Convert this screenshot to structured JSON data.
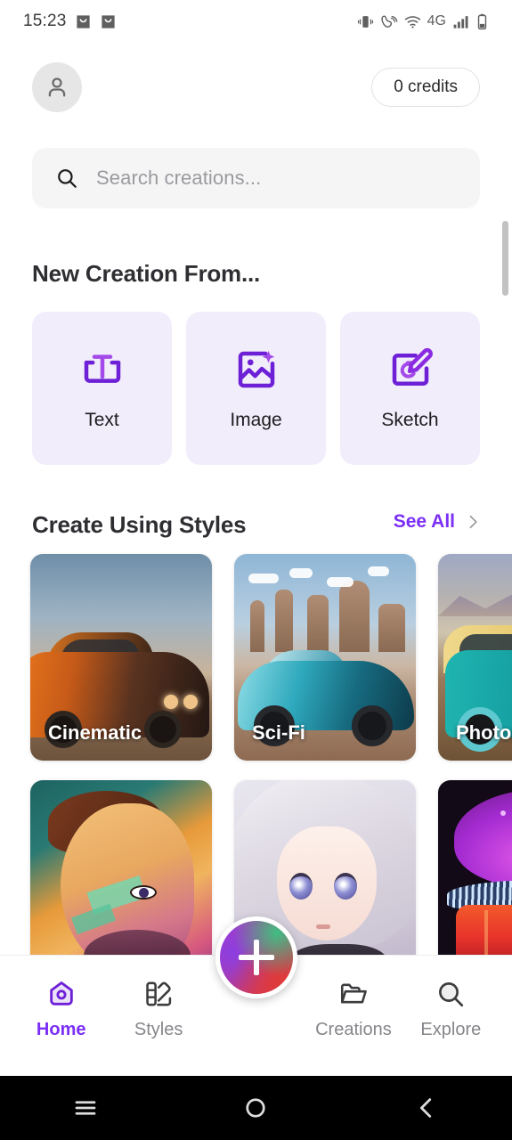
{
  "status_bar": {
    "time": "15:23",
    "left_icons": [
      "inbox-icon",
      "inbox-icon"
    ],
    "right_icons": [
      "vibrate-icon",
      "wifi-calling-icon",
      "wifi-icon",
      "signal-bars-icon",
      "battery-icon"
    ],
    "network_label": "4G"
  },
  "top_bar": {
    "avatar_icon": "person-icon",
    "credits_label": "0 credits"
  },
  "search": {
    "icon": "search-icon",
    "placeholder": "Search creations...",
    "value": ""
  },
  "new_creation": {
    "heading": "New Creation From...",
    "cards": [
      {
        "label": "Text",
        "icon": "text-box-icon"
      },
      {
        "label": "Image",
        "icon": "image-sparkle-icon"
      },
      {
        "label": "Sketch",
        "icon": "sketch-pencil-icon"
      }
    ]
  },
  "styles_section": {
    "heading": "Create Using Styles",
    "see_all_label": "See All",
    "chevron_icon": "chevron-right-icon",
    "row1": [
      {
        "label": "Cinematic",
        "art": "cinematic"
      },
      {
        "label": "Sci-Fi",
        "art": "scifi"
      },
      {
        "label": "Photographic",
        "art": "photo"
      }
    ],
    "row2": [
      {
        "label": "",
        "art": "comic"
      },
      {
        "label": "",
        "art": "anime"
      },
      {
        "label": "",
        "art": "neon"
      }
    ]
  },
  "bottom_nav": {
    "items": [
      {
        "label": "Home",
        "icon": "home-icon",
        "active": true
      },
      {
        "label": "Styles",
        "icon": "palette-icon",
        "active": false
      },
      {
        "label": "Creations",
        "icon": "folder-icon",
        "active": false
      },
      {
        "label": "Explore",
        "icon": "search-icon",
        "active": false
      }
    ],
    "fab_icon": "plus-icon"
  },
  "android_nav": {
    "recents_icon": "menu-icon",
    "home_icon": "circle-icon",
    "back_icon": "chevron-left-icon"
  },
  "colors": {
    "accent": "#7b2ff7",
    "card_bg": "#f1edfb",
    "search_bg": "#f5f5f6",
    "text_primary": "#2f2f33",
    "text_muted": "#86868b"
  }
}
